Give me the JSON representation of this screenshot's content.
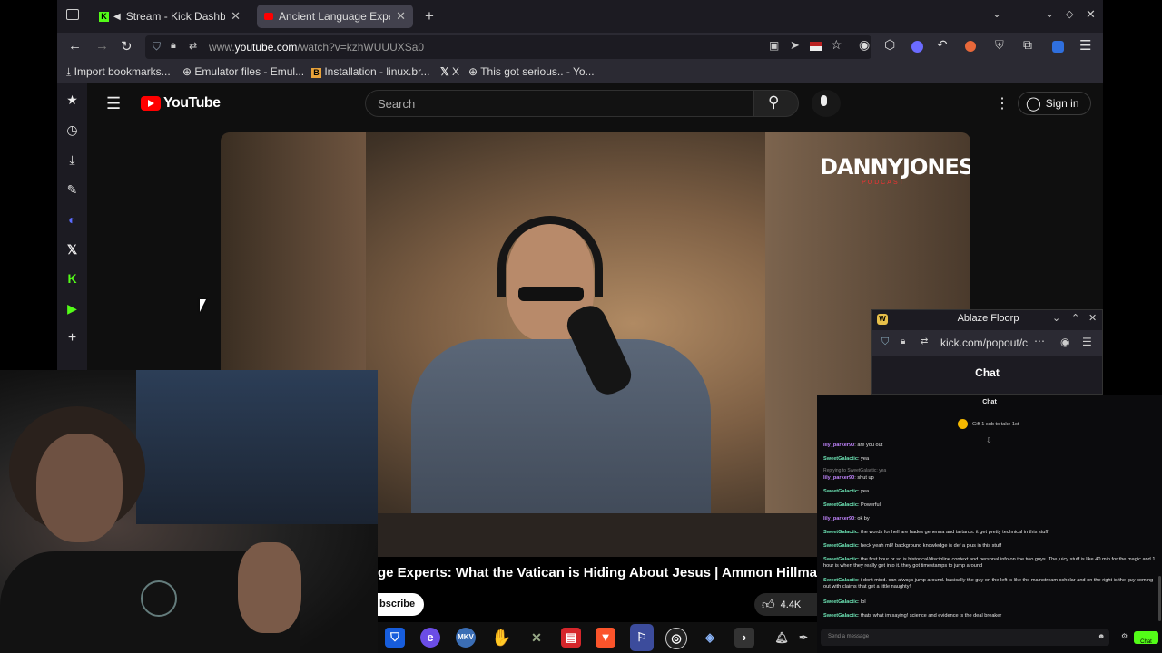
{
  "browser": {
    "tabs": [
      {
        "label": "Stream - Kick Dashboa"
      },
      {
        "label": "Ancient Language Experts"
      }
    ],
    "url_prefix": "www.",
    "url_domain": "youtube.com",
    "url_path": "/watch?v=kzhWUUUXSa0",
    "bookmarks": [
      {
        "label": "Import bookmarks..."
      },
      {
        "label": "Emulator files - Emul..."
      },
      {
        "label": "Installation - linux.br..."
      },
      {
        "label": "X"
      },
      {
        "label": "This got serious.. - Yo..."
      }
    ]
  },
  "youtube": {
    "logo_text": "YouTube",
    "search_placeholder": "Search",
    "sign_in": "Sign in",
    "channel_logo": "DANNYJONES",
    "channel_logo_sub": "PODCAST",
    "video_title": "ge Experts: What the Vatican is Hiding About Jesus | Ammon Hillman",
    "subscribe": "bscribe",
    "likes": "4.4K"
  },
  "popout": {
    "title": "Ablaze Floorp",
    "url": "kick.com/popout/c",
    "heading": "Chat"
  },
  "chat": {
    "header": "Chat",
    "pinned": "Gift 1 sub to take 1st",
    "messages": [
      {
        "user": "lily_parker90",
        "text": "are you out"
      },
      {
        "user": "SweetGalactic",
        "text": "yea"
      },
      {
        "user": "",
        "text": "Replying to SweetGalactic: yea"
      },
      {
        "user": "lily_parker90",
        "text": "shut up"
      },
      {
        "user": "SweetGalactic",
        "text": "yea"
      },
      {
        "user": "SweetGalactic",
        "text": "Powerful!"
      },
      {
        "user": "lily_parker90",
        "text": "ok by"
      },
      {
        "user": "SweetGalactic",
        "text": "the words for hell are hades gehenna and tartarus. it get pretty technical in this stuff"
      },
      {
        "user": "SweetGalactic",
        "text": "heck yeah m8! background knowledge is def a plus in this stuff"
      },
      {
        "user": "SweetGalactic",
        "text": "the first hour or so is historical/discipline context and personal info on the two guys. The juicy stuff is like 40 min for the magic and 1 hour is when they really get into it. they got timestamps to jump around"
      },
      {
        "user": "SweetGalactic",
        "text": "i dont mind. can always jump around. basically the guy on the left is like the mainstream scholar and on the right is the guy coming out with claims that get a little naughty!"
      },
      {
        "user": "SweetGalactic",
        "text": "lol"
      },
      {
        "user": "SweetGalactic",
        "text": "thats what im saying! science and evidence is the deal breaker"
      }
    ],
    "input_placeholder": "Send a message",
    "send_label": "Chat"
  },
  "colors": {
    "yt_red": "#ff0000",
    "kick_green": "#53fc18",
    "chat_user": "#c084fc"
  }
}
